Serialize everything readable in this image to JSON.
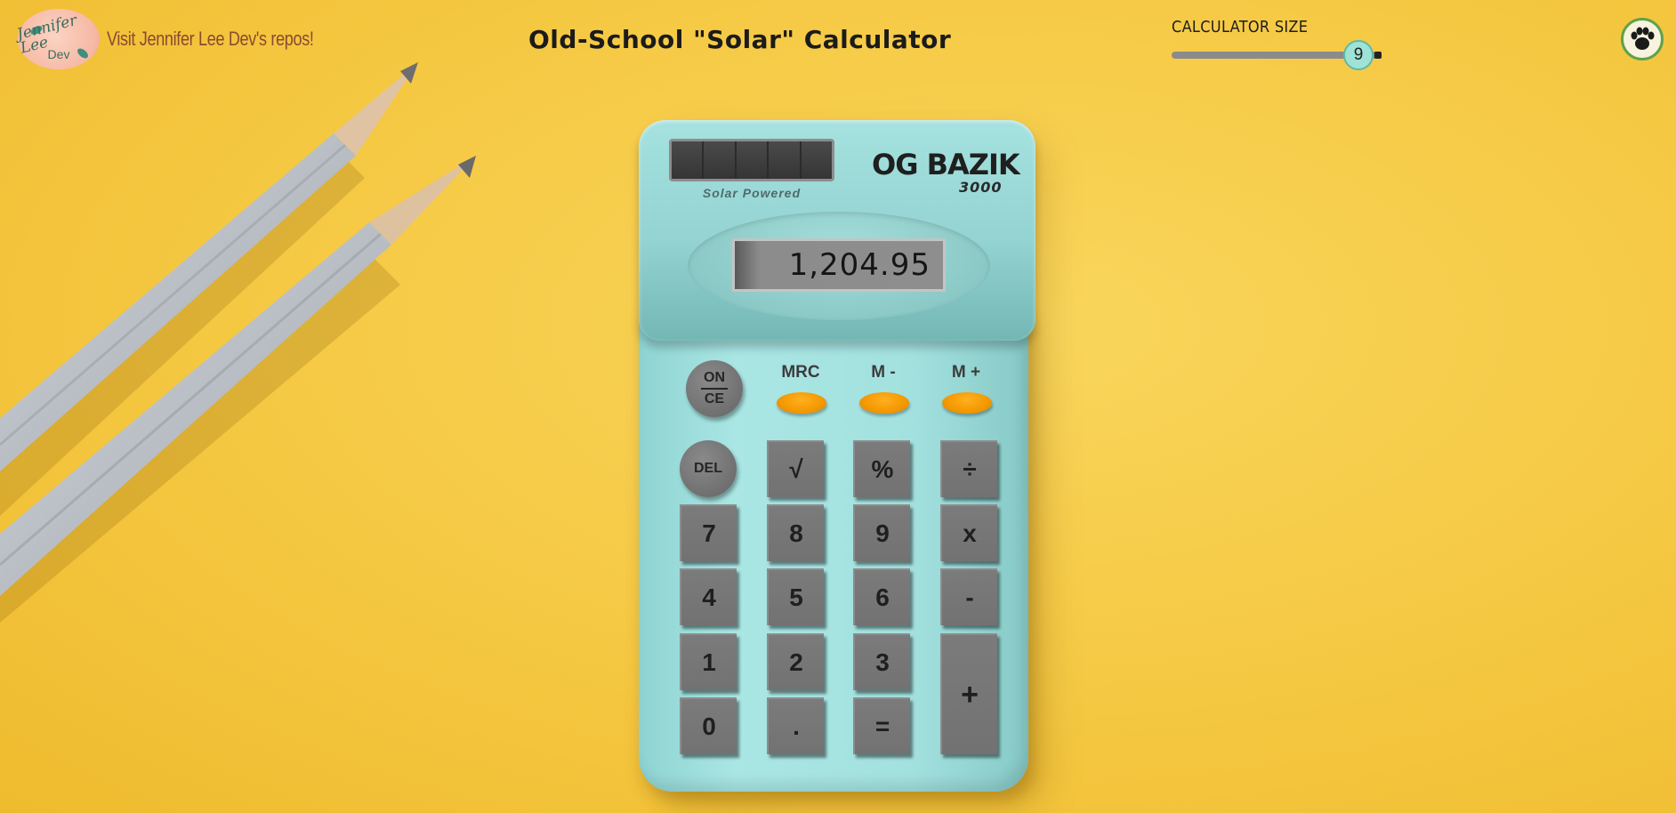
{
  "header": {
    "logo_line1": "Jennifer Lee",
    "logo_line2": "Dev",
    "repo_link": "Visit Jennifer Lee Dev's repos!",
    "title": "Old-School \"Solar\" Calculator"
  },
  "size_control": {
    "label": "CALCULATOR SIZE",
    "value": "9"
  },
  "calculator": {
    "solar_label": "Solar Powered",
    "brand": "OG BAZIK",
    "model": "3000",
    "display": "1,204.95",
    "on_ce": {
      "top": "ON",
      "bottom": "CE"
    },
    "memory": [
      {
        "label": "MRC"
      },
      {
        "label": "M -"
      },
      {
        "label": "M +"
      }
    ],
    "del": "DEL",
    "keys": {
      "sqrt": "√",
      "percent": "%",
      "divide": "÷",
      "k7": "7",
      "k8": "8",
      "k9": "9",
      "multiply": "x",
      "k4": "4",
      "k5": "5",
      "k6": "6",
      "minus": "-",
      "k1": "1",
      "k2": "2",
      "k3": "3",
      "plus": "+",
      "k0": "0",
      "dot": ".",
      "equals": "="
    }
  },
  "colors": {
    "background": "#f5c842",
    "calculator_body": "#a3e1df",
    "memory_button": "#f39800",
    "key": "#737373",
    "slider_thumb": "#9fe3d6"
  }
}
